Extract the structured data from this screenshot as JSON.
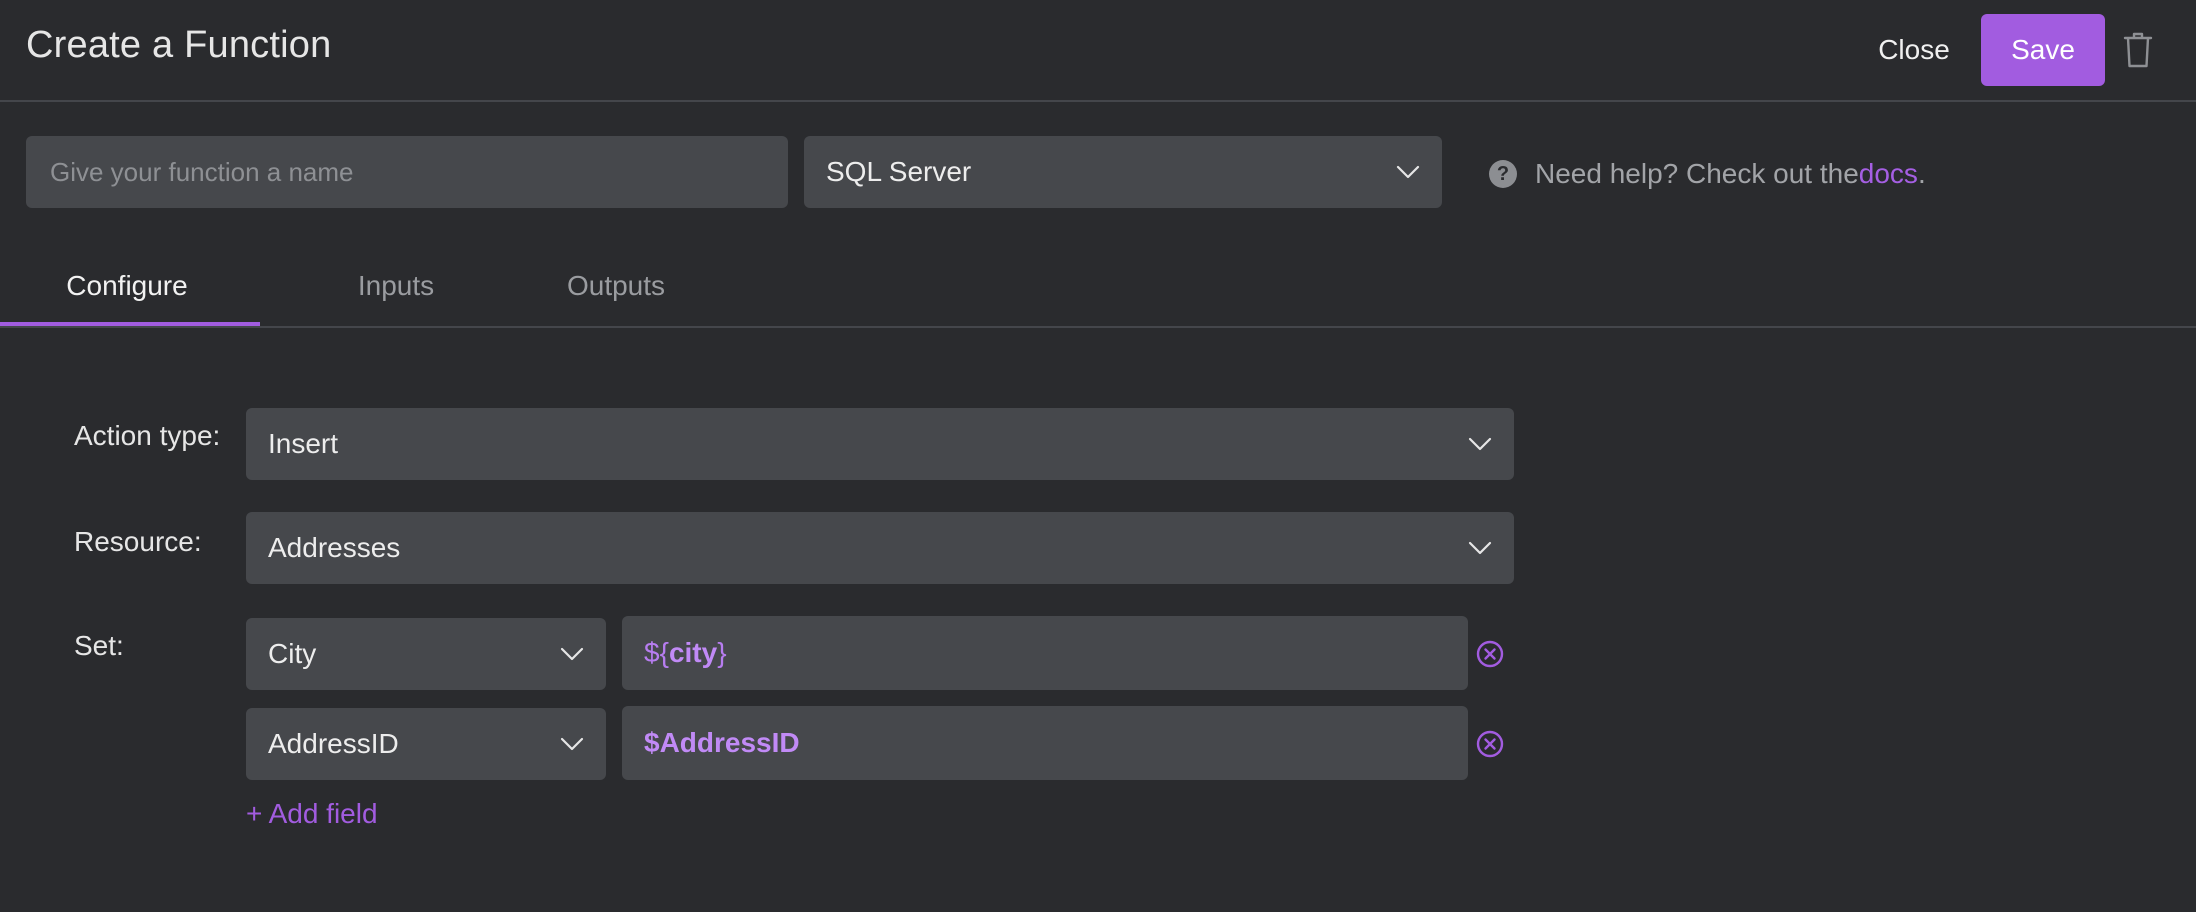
{
  "header": {
    "title": "Create a Function",
    "close_label": "Close",
    "save_label": "Save",
    "delete_icon": "trash-icon"
  },
  "function_name": {
    "placeholder": "Give your function a name",
    "value": ""
  },
  "datasource": {
    "selected": "SQL Server"
  },
  "help": {
    "icon": "question-circle-icon",
    "text": "Need help? Check out the ",
    "link": "docs",
    "suffix": "."
  },
  "tabs": [
    {
      "label": "Configure",
      "active": true
    },
    {
      "label": "Inputs",
      "active": false
    },
    {
      "label": "Outputs",
      "active": false
    }
  ],
  "form": {
    "action_type_label": "Action type:",
    "action_type_value": "Insert",
    "resource_label": "Resource:",
    "resource_value": "Addresses",
    "set_label": "Set:",
    "set_rows": [
      {
        "field": "City",
        "value_prefix": "${",
        "value_bold": "city",
        "value_suffix": "}"
      },
      {
        "field": "AddressID",
        "value_prefix": "",
        "value_bold": "$AddressID",
        "value_suffix": ""
      }
    ],
    "add_field_label": "+ Add field"
  },
  "colors": {
    "background": "#2a2b2e",
    "field_background": "#46484c",
    "accent": "#a25ce0",
    "divider": "#44464b"
  }
}
